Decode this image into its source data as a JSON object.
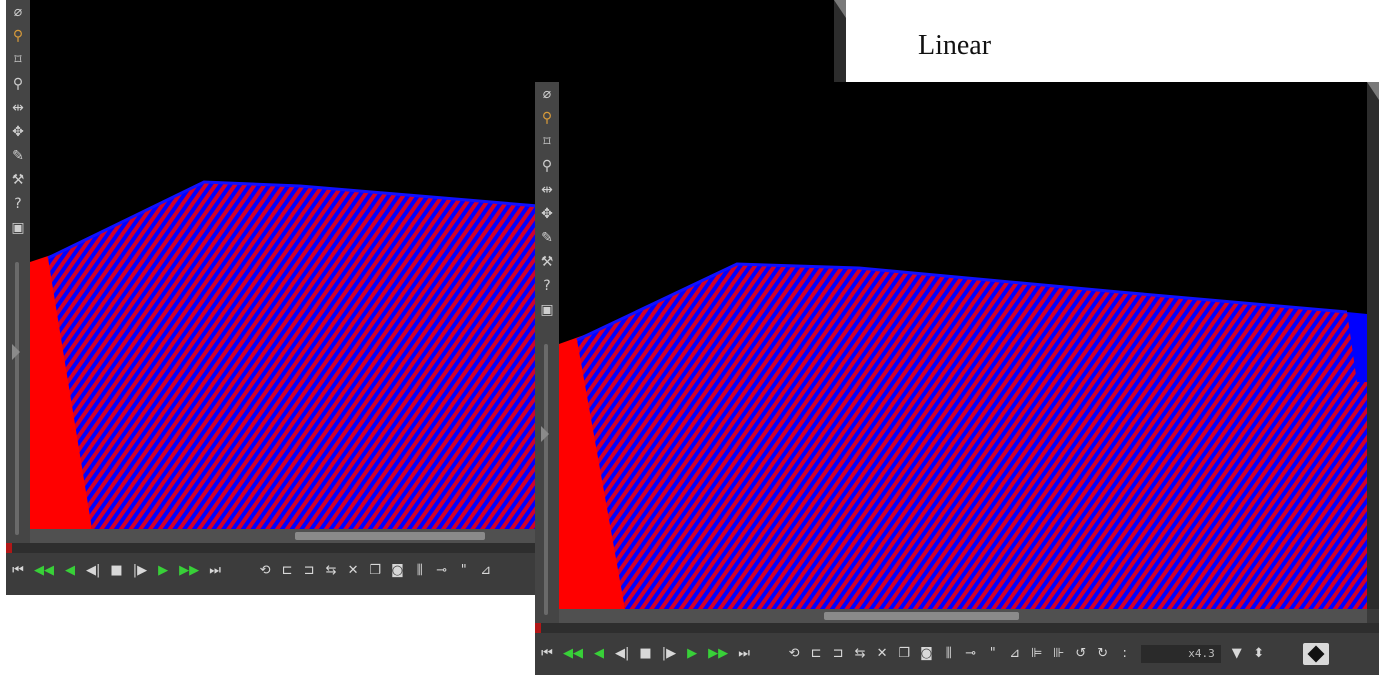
{
  "caption": "Linear",
  "colors": {
    "surface_red": "#ff0000",
    "surface_blue": "#0000ff",
    "background": "#000000",
    "panel": "#3a3a3a",
    "play_green": "#38d038",
    "active_tool": "#d79a3a"
  },
  "tools": [
    {
      "icon": "no-entry-icon",
      "glyph": "⌀"
    },
    {
      "icon": "magnify-icon",
      "glyph": "⚲"
    },
    {
      "icon": "lasso-icon",
      "glyph": "⌑"
    },
    {
      "icon": "figure-icon",
      "glyph": "⚲"
    },
    {
      "icon": "move-horizontal-icon",
      "glyph": "⇹"
    },
    {
      "icon": "move-arrows-icon",
      "glyph": "✥"
    },
    {
      "icon": "pencil-icon",
      "glyph": "✎"
    },
    {
      "icon": "dropper-icon",
      "glyph": "⚒"
    },
    {
      "icon": "help-icon",
      "glyph": "?"
    },
    {
      "icon": "frame-icon",
      "glyph": "▣"
    }
  ],
  "transport": {
    "buttons": [
      {
        "icon": "skip-start-icon",
        "glyph": "⏮",
        "green": false
      },
      {
        "icon": "fast-reverse-icon",
        "glyph": "◀◀",
        "green": true
      },
      {
        "icon": "reverse-play-icon",
        "glyph": "◀",
        "green": true
      },
      {
        "icon": "step-back-icon",
        "glyph": "◀|",
        "green": false
      },
      {
        "icon": "stop-icon",
        "glyph": "■",
        "green": false
      },
      {
        "icon": "step-forward-icon",
        "glyph": "|▶",
        "green": false
      },
      {
        "icon": "play-icon",
        "glyph": "▶",
        "green": true
      },
      {
        "icon": "fast-forward-icon",
        "glyph": "▶▶",
        "green": true
      },
      {
        "icon": "skip-end-icon",
        "glyph": "⏭",
        "green": false
      }
    ],
    "tools": [
      {
        "icon": "loop-icon",
        "glyph": "⟲"
      },
      {
        "icon": "mark-in-icon",
        "glyph": "⊏"
      },
      {
        "icon": "mark-out-icon",
        "glyph": "⊐"
      },
      {
        "icon": "swap-icon",
        "glyph": "⇆"
      },
      {
        "icon": "cross-icon",
        "glyph": "✕"
      },
      {
        "icon": "copy-frame-icon",
        "glyph": "❐"
      },
      {
        "icon": "snapshot-icon",
        "glyph": "◙"
      },
      {
        "icon": "film-icon",
        "glyph": "⫼"
      },
      {
        "icon": "link-icon",
        "glyph": "⊸"
      },
      {
        "icon": "quote-icon",
        "glyph": "\""
      },
      {
        "icon": "level-icon",
        "glyph": "⊿"
      },
      {
        "icon": "align-left-icon",
        "glyph": "⊫"
      },
      {
        "icon": "align-center-icon",
        "glyph": "⊪"
      },
      {
        "icon": "rotate-icon",
        "glyph": "↺"
      },
      {
        "icon": "rotate-alt-icon",
        "glyph": "↻"
      },
      {
        "icon": "colon-icon",
        "glyph": ":"
      }
    ],
    "counter_value": "x4.3",
    "counter_flag_glyph": "▼",
    "spinner_glyph": "⬍"
  }
}
